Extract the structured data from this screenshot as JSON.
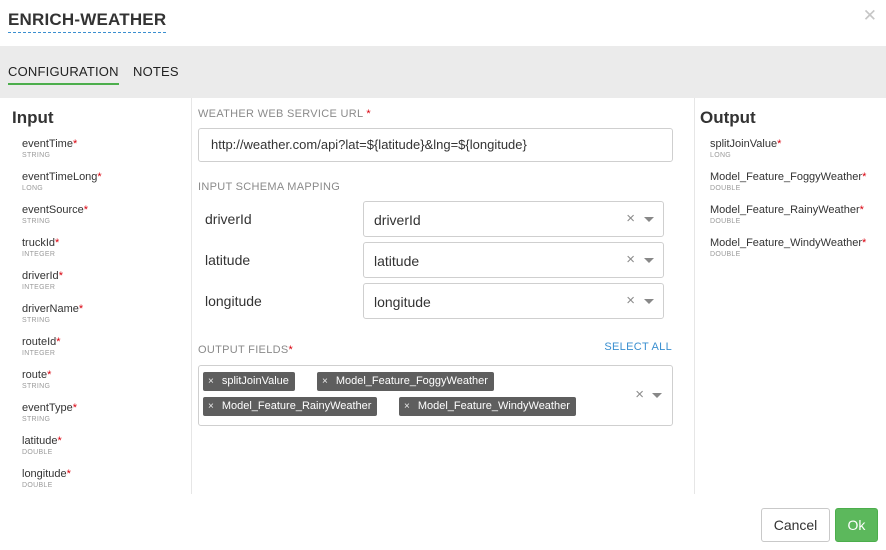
{
  "header": {
    "title": "ENRICH-WEATHER",
    "close_glyph": "✕"
  },
  "tabs": [
    {
      "label": "CONFIGURATION",
      "active": true
    },
    {
      "label": "NOTES",
      "active": false
    }
  ],
  "input_panel": {
    "title": "Input",
    "fields": [
      {
        "name": "eventTime",
        "type": "STRING",
        "required": "*"
      },
      {
        "name": "eventTimeLong",
        "type": "LONG",
        "required": "*"
      },
      {
        "name": "eventSource",
        "type": "STRING",
        "required": "*"
      },
      {
        "name": "truckId",
        "type": "INTEGER",
        "required": "*"
      },
      {
        "name": "driverId",
        "type": "INTEGER",
        "required": "*"
      },
      {
        "name": "driverName",
        "type": "STRING",
        "required": "*"
      },
      {
        "name": "routeId",
        "type": "INTEGER",
        "required": "*"
      },
      {
        "name": "route",
        "type": "STRING",
        "required": "*"
      },
      {
        "name": "eventType",
        "type": "STRING",
        "required": "*"
      },
      {
        "name": "latitude",
        "type": "DOUBLE",
        "required": "*"
      },
      {
        "name": "longitude",
        "type": "DOUBLE",
        "required": "*"
      }
    ]
  },
  "output_panel": {
    "title": "Output",
    "fields": [
      {
        "name": "splitJoinValue",
        "type": "LONG",
        "required": "*"
      },
      {
        "name": "Model_Feature_FoggyWeather",
        "type": "DOUBLE",
        "required": "*"
      },
      {
        "name": "Model_Feature_RainyWeather",
        "type": "DOUBLE",
        "required": "*"
      },
      {
        "name": "Model_Feature_WindyWeather",
        "type": "DOUBLE",
        "required": "*"
      }
    ]
  },
  "config": {
    "url_label": "WEATHER WEB SERVICE URL",
    "url_required": "*",
    "url_value": "http://weather.com/api?lat=${latitude}&lng=${longitude}",
    "mapping_label": "INPUT SCHEMA MAPPING",
    "mappings": [
      {
        "label": "driverId",
        "value": "driverId"
      },
      {
        "label": "latitude",
        "value": "latitude"
      },
      {
        "label": "longitude",
        "value": "longitude"
      }
    ],
    "output_fields_label": "OUTPUT FIELDS",
    "output_fields_required": "*",
    "select_all_label": "SELECT ALL",
    "output_fields": [
      "splitJoinValue",
      "Model_Feature_FoggyWeather",
      "Model_Feature_RainyWeather",
      "Model_Feature_WindyWeather"
    ],
    "clear_glyph": "×",
    "chip_remove_glyph": "×"
  },
  "footer": {
    "cancel_label": "Cancel",
    "ok_label": "Ok"
  },
  "colors": {
    "accent_green": "#5cb85c",
    "link_blue": "#3a8fd0",
    "required_red": "#d9000d",
    "chip_bg": "#5e5e5e"
  }
}
